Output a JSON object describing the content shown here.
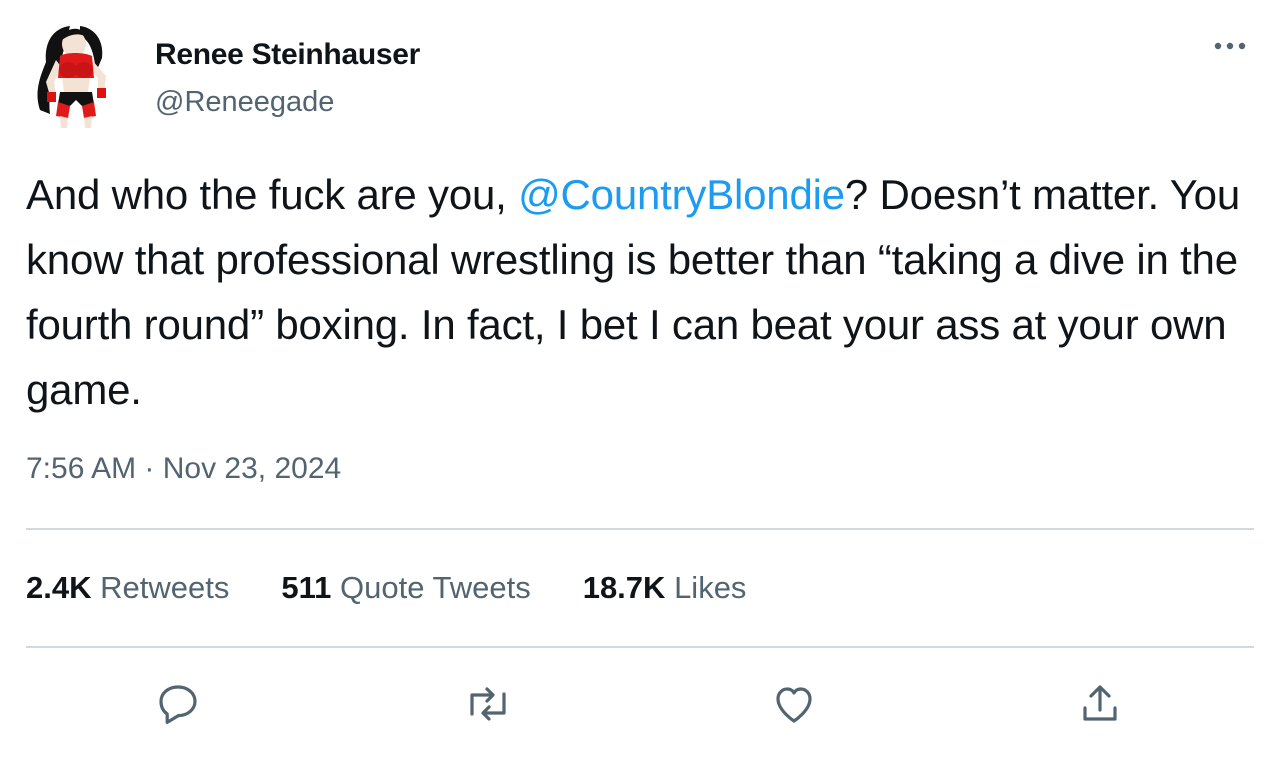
{
  "author": {
    "display_name": "Renee Steinhauser",
    "handle": "@Reneegade",
    "avatar_icon": "cartoon-wrestler-avatar"
  },
  "tweet": {
    "text_before": "And who the fuck are you, ",
    "mention": "@CountryBlondie",
    "text_after": "? Doesn’t matter. You know that professional wrestling is better than “taking a dive in the fourth round” boxing. In fact, I bet I can beat your ass at your own game.",
    "timestamp": "7:56 AM · Nov 23, 2024"
  },
  "stats": {
    "retweets": {
      "count": "2.4K",
      "label": "Retweets"
    },
    "quotes": {
      "count": "511",
      "label": "Quote Tweets"
    },
    "likes": {
      "count": "18.7K",
      "label": "Likes"
    }
  },
  "actions": [
    "reply-icon",
    "retweet-icon",
    "like-icon",
    "share-icon"
  ],
  "colors": {
    "text": "#0f1419",
    "secondary": "#536471",
    "link": "#1d9bf0",
    "divider": "#cfd9de"
  }
}
